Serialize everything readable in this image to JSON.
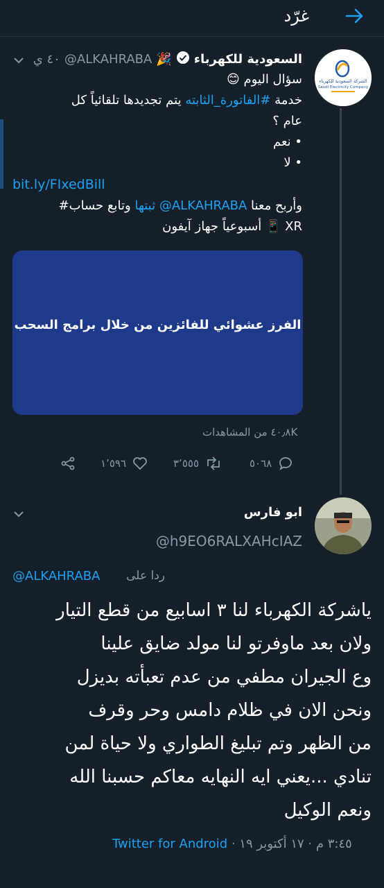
{
  "header": {
    "back_icon": "arrow-icon",
    "title": "غرّد"
  },
  "tweet1": {
    "author_name": "السعودية للكهرباء",
    "emoji_party": "🎉",
    "handle": "@ALKAHRABA",
    "time": "٤٠ ي",
    "line1": "سؤال اليوم 😊",
    "line2_a": "خدمة ",
    "hashtag1": "#الفاتورة_الثابته",
    "line2_b": " يتم تجديدها تلقائياً كل",
    "line3": "عام ؟",
    "option_yes": "• نعم",
    "option_no": "• لا",
    "link": "bit.ly/FIxedBill",
    "promo_a": "وأربح معنا ",
    "promo_mention": "@ALKAHRABA",
    "promo_hash": " ثبتها",
    "promo_b": " وتابع حساب#",
    "promo_line2": "XR 📱 أسبوعياً جهاز آيفون",
    "media_text": "الفرز عشوائي للفائزين من خلال برامج السحب",
    "views": "٤٠٫٨K من المشاهدات",
    "replies": "٥٠٦٨",
    "retweets": "٣٬٥٥٥",
    "likes": "١٬٥٩٦",
    "logo_text_ar": "الشركة السعودية للكهرباء",
    "logo_text_en": "Saudi Electricity Company"
  },
  "tweet2": {
    "author_name": "ابو فارس",
    "handle": "@h9EO6RALXAHcIAZ",
    "reply_to_label": "ردا على",
    "reply_to_handle": "@ALKAHRABA",
    "body_lines": [
      "ياشركة الكهرباء لنا ٣ اسابيع من قطع التيار",
      "ولان بعد ماوفرتو لنا مولد ضايق علينا",
      "وع الجيران مطفي من عدم تعبأته بديزل",
      "ونحن الان في ظلام دامس وحر وقرف",
      "من الظهر وتم تبليغ الطواري ولا حياة لمن",
      "تنادي ...يعني ايه النهايه معاكم حسبنا الله",
      "ونعم الوكيل"
    ],
    "timestamp": "٣:٤٥ م · ١٧ أكتوبر ١٩ · ",
    "source": "Twitter for Android"
  },
  "colors": {
    "background": "#15202b",
    "accent": "#1da1f2",
    "muted": "#8899a6",
    "media": "#1f3a8a"
  }
}
